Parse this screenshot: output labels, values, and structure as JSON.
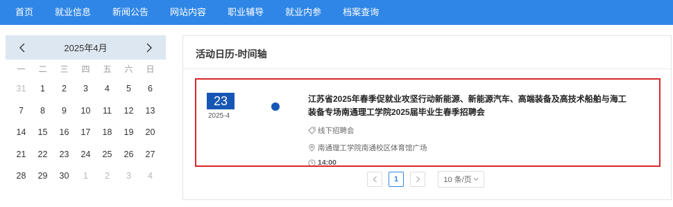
{
  "nav": {
    "items": [
      "首页",
      "就业信息",
      "新闻公告",
      "网站内容",
      "职业辅导",
      "就业内参",
      "档案查询"
    ]
  },
  "calendar": {
    "month_label": "2025年4月",
    "weekdays": [
      "一",
      "二",
      "三",
      "四",
      "五",
      "六",
      "日"
    ],
    "days": [
      {
        "d": "31",
        "muted": true
      },
      {
        "d": "1"
      },
      {
        "d": "2"
      },
      {
        "d": "3"
      },
      {
        "d": "4"
      },
      {
        "d": "5"
      },
      {
        "d": "6"
      },
      {
        "d": "7"
      },
      {
        "d": "8"
      },
      {
        "d": "9"
      },
      {
        "d": "10"
      },
      {
        "d": "11"
      },
      {
        "d": "12"
      },
      {
        "d": "13"
      },
      {
        "d": "14"
      },
      {
        "d": "15"
      },
      {
        "d": "16"
      },
      {
        "d": "17"
      },
      {
        "d": "18"
      },
      {
        "d": "19"
      },
      {
        "d": "20"
      },
      {
        "d": "21"
      },
      {
        "d": "22"
      },
      {
        "d": "23"
      },
      {
        "d": "24"
      },
      {
        "d": "25"
      },
      {
        "d": "26"
      },
      {
        "d": "27"
      },
      {
        "d": "28"
      },
      {
        "d": "29"
      },
      {
        "d": "30"
      },
      {
        "d": "1",
        "muted": true
      },
      {
        "d": "2",
        "muted": true
      },
      {
        "d": "3",
        "muted": true
      },
      {
        "d": "4",
        "muted": true
      }
    ]
  },
  "panel": {
    "title": "活动日历-时间轴"
  },
  "event": {
    "day": "23",
    "year_month": "2025-4",
    "title": "江苏省2025年春季促就业攻坚行动新能源、新能源汽车、高端装备及高技术船舶与海工装备专场南通理工学院2025届毕业生春季招聘会",
    "type": "线下招聘会",
    "location": "南通理工学院南通校区体育馆广场",
    "time": "14:00"
  },
  "pagination": {
    "current_page": "1",
    "page_size_label": "10 条/页"
  },
  "colors": {
    "nav_bg": "#2f86e6",
    "accent_blue": "#1657b5",
    "highlight_red": "#d9262b",
    "calendar_header_bg": "#dde7f2"
  }
}
